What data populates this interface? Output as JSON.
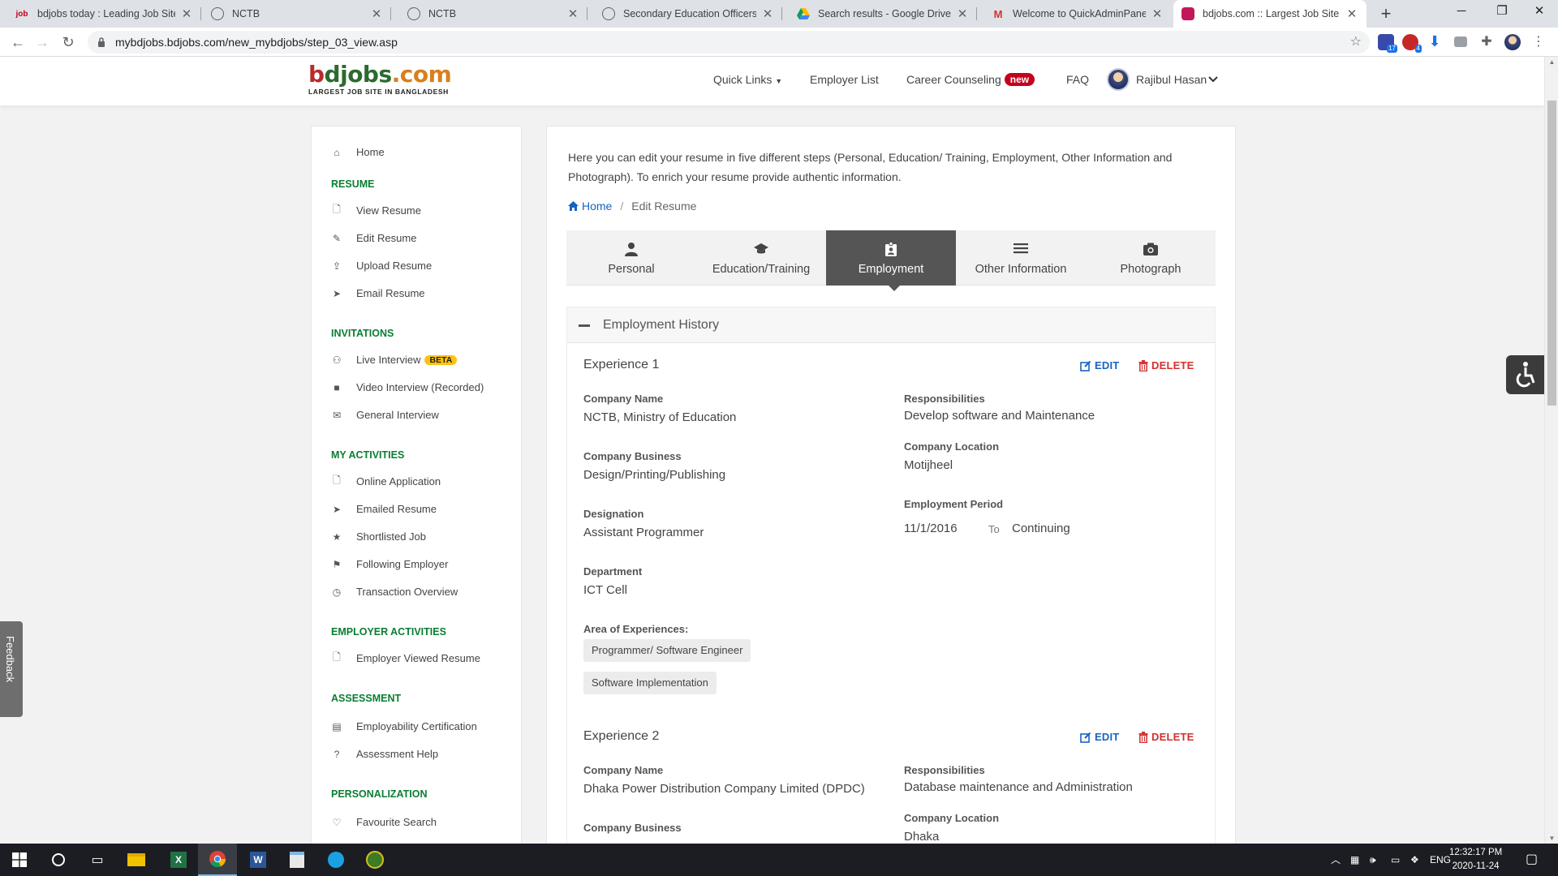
{
  "browser": {
    "tabs": [
      {
        "title": "bdjobs today : Leading Job Site in Bangladesh",
        "fav": "job"
      },
      {
        "title": "NCTB",
        "fav": ""
      },
      {
        "title": "NCTB",
        "fav": ""
      },
      {
        "title": "Secondary Education Officers",
        "fav": ""
      },
      {
        "title": "Search results - Google Drive",
        "fav": ""
      },
      {
        "title": "Welcome to QuickAdminPanel - Gmail",
        "fav": "M"
      },
      {
        "title": "bdjobs.com :: Largest Job Site in Bangladesh",
        "fav": ""
      }
    ],
    "url": "mybdjobs.bdjobs.com/new_mybdjobs/step_03_view.asp",
    "ext_badges": [
      "17",
      "4"
    ]
  },
  "site": {
    "logo_b": "b",
    "logo_d": "d",
    "logo_rest": "jobs",
    "logo_com": ".com",
    "tagline": "LARGEST JOB SITE IN BANGLADESH",
    "nav": {
      "quick_links": "Quick Links",
      "employer_list": "Employer List",
      "career_counseling": "Career Counseling",
      "new_badge": "new",
      "faq": "FAQ",
      "user_name": "Rajibul Hasan"
    }
  },
  "sidebar": {
    "home": "Home",
    "sections": [
      {
        "heading": "RESUME",
        "items": [
          "View Resume",
          "Edit Resume",
          "Upload Resume",
          "Email Resume"
        ]
      },
      {
        "heading": "INVITATIONS",
        "items": [
          "Live Interview",
          "Video Interview (Recorded)",
          "General Interview"
        ]
      },
      {
        "heading": "MY ACTIVITIES",
        "items": [
          "Online Application",
          "Emailed Resume",
          "Shortlisted Job",
          "Following Employer",
          "Transaction Overview"
        ]
      },
      {
        "heading": "EMPLOYER ACTIVITIES",
        "items": [
          "Employer Viewed Resume"
        ]
      },
      {
        "heading": "ASSESSMENT",
        "items": [
          "Employability Certification",
          "Assessment Help"
        ]
      },
      {
        "heading": "PERSONALIZATION",
        "items": [
          "Favourite Search"
        ]
      }
    ],
    "beta_badge": "BETA"
  },
  "main": {
    "intro": "Here you can edit your resume in five different steps (Personal, Education/ Training, Employment, Other Information and Photograph). To enrich your resume provide authentic information.",
    "breadcrumb": {
      "home": "Home",
      "current": "Edit Resume"
    },
    "steps": [
      "Personal",
      "Education/Training",
      "Employment",
      "Other Information",
      "Photograph"
    ],
    "active_step": "Employment",
    "section_title": "Employment History",
    "labels": {
      "company_name": "Company Name",
      "company_business": "Company Business",
      "designation": "Designation",
      "department": "Department",
      "area": "Area of Experiences:",
      "responsibilities": "Responsibilities",
      "company_location": "Company Location",
      "employment_period": "Employment Period",
      "to": "To",
      "edit": "EDIT",
      "delete": "DELETE"
    },
    "experiences": [
      {
        "title": "Experience 1",
        "company_name": "NCTB, Ministry of Education",
        "company_business": "Design/Printing/Publishing",
        "designation": "Assistant Programmer",
        "department": "ICT Cell",
        "areas": [
          "Programmer/ Software Engineer",
          "Software Implementation"
        ],
        "responsibilities": "Develop software and Maintenance",
        "company_location": "Motijheel",
        "period_from": "11/1/2016",
        "period_to": "Continuing"
      },
      {
        "title": "Experience 2",
        "company_name": "Dhaka Power Distribution Company Limited (DPDC)",
        "responsibilities": "Database maintenance and Administration",
        "company_location": "Dhaka"
      }
    ]
  },
  "widgets": {
    "feedback": "Feedback"
  },
  "taskbar": {
    "lang": "ENG",
    "time": "12:32:17 PM",
    "date": "2020-11-24"
  },
  "colors": {
    "accent_green": "#0a7e32",
    "link_blue": "#1565c0",
    "delete_red": "#d32f2f",
    "active_tab": "#555555",
    "new_badge": "#c4001d",
    "beta_badge": "#ffc20e"
  }
}
